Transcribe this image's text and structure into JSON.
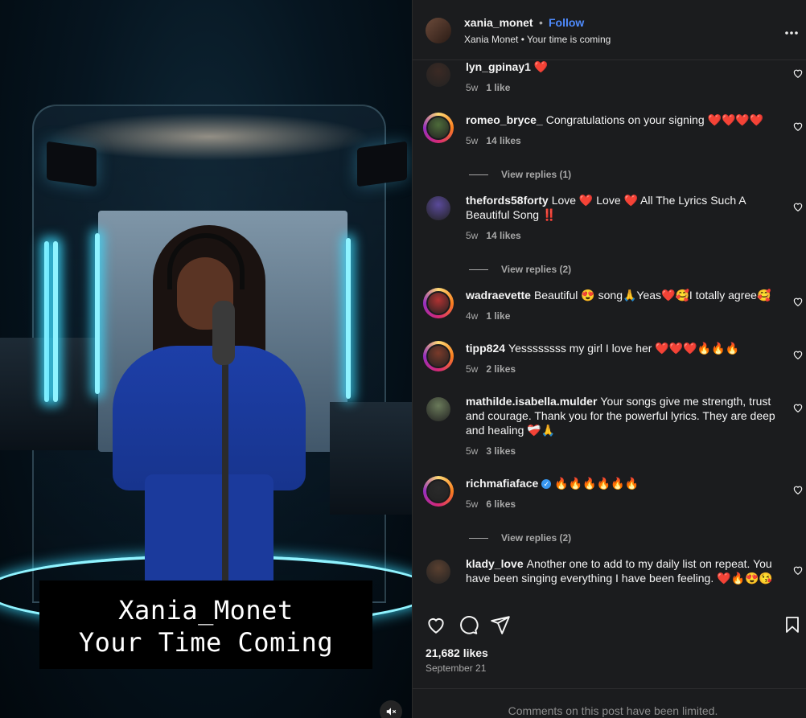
{
  "media": {
    "caption_line1": "Xania_Monet",
    "caption_line2": "Your Time Coming",
    "mute_icon": "speaker-muted-icon"
  },
  "header": {
    "username": "xania_monet",
    "separator": "•",
    "follow_label": "Follow",
    "subtitle": "Xania Monet • Your time is coming",
    "more_icon": "more-horizontal-icon"
  },
  "comments": [
    {
      "user": "lyn_gpinay1",
      "text": "❤️",
      "age": "5w",
      "likes": "1 like",
      "avatar_color": "#3b2a24",
      "ring": false
    },
    {
      "user": "romeo_bryce_",
      "text": "Congratulations on your signing ❤️❤️❤️❤️",
      "age": "5w",
      "likes": "14 likes",
      "avatar_color": "#4d6b3a",
      "ring": true,
      "replies": "View replies (1)"
    },
    {
      "user": "thefords58forty",
      "text": "Love ❤️ Love ❤️ All The Lyrics Such A Beautiful Song ‼️",
      "age": "5w",
      "likes": "14 likes",
      "avatar_color": "#5a4a9a",
      "ring": false,
      "replies": "View replies (2)"
    },
    {
      "user": "wadraevette",
      "text": "Beautiful 😍 song🙏Yeas❤️🥰I totally agree🥰",
      "age": "4w",
      "likes": "1 like",
      "avatar_color": "#b03232",
      "ring": true
    },
    {
      "user": "tipp824",
      "text": "Yessssssss my girl I love her ❤️❤️❤️🔥🔥🔥",
      "age": "5w",
      "likes": "2 likes",
      "avatar_color": "#7a3a2a",
      "ring": true
    },
    {
      "user": "mathilde.isabella.mulder",
      "text": "Your songs give me strength, trust and courage. Thank you for the powerful lyrics. They are deep and healing ❤️‍🩹🙏",
      "age": "5w",
      "likes": "3 likes",
      "avatar_color": "#6a7a5a",
      "ring": false
    },
    {
      "user": "richmafiaface",
      "text": "🔥🔥🔥🔥🔥🔥",
      "age": "5w",
      "likes": "6 likes",
      "avatar_color": "#2a2a2a",
      "ring": true,
      "verified": true,
      "replies": "View replies (2)"
    },
    {
      "user": "klady_love",
      "text": "Another one to add to my daily list on repeat. You have been singing everything I have been feeling. ❤️🔥😍😘",
      "age": "",
      "likes": "",
      "avatar_color": "#5a4030",
      "ring": false
    }
  ],
  "actions": {
    "like_icon": "heart-icon",
    "comment_icon": "comment-icon",
    "share_icon": "share-icon",
    "save_icon": "bookmark-icon"
  },
  "stats": {
    "likes": "21,682 likes",
    "date": "September 21"
  },
  "footer": {
    "limited_text": "Comments on this post have been limited."
  },
  "colors": {
    "panel_bg": "#1b1c1e",
    "follow": "#4f8cff",
    "muted_text": "#a8a8a8",
    "verified": "#3897f0"
  }
}
